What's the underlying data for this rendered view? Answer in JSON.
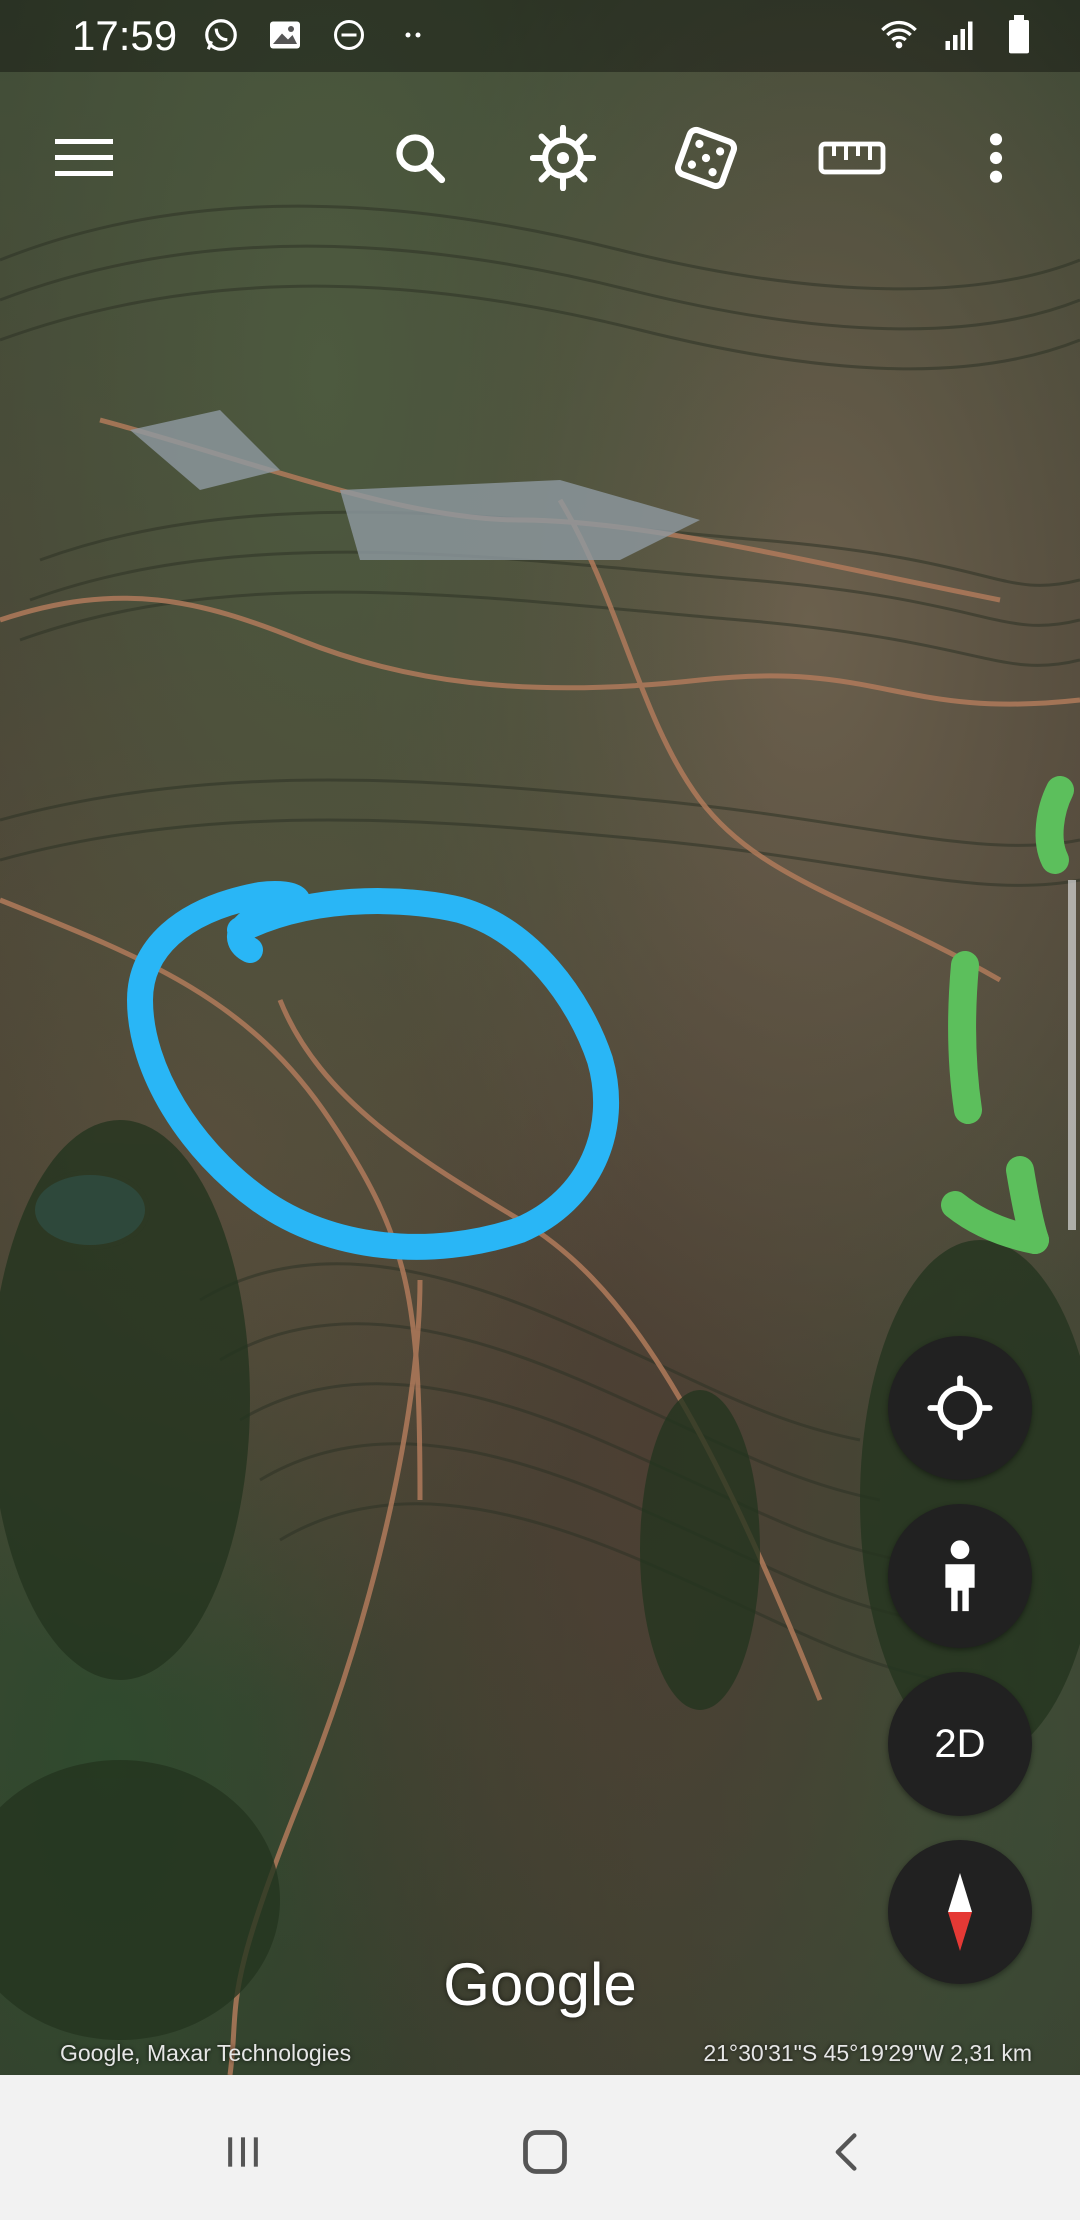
{
  "status_bar": {
    "time": "17:59",
    "left_icons": [
      "whatsapp-icon",
      "gallery-icon",
      "do-not-disturb-icon",
      "more-dots-icon"
    ],
    "right_icons": [
      "wifi-icon",
      "signal-icon",
      "battery-icon"
    ]
  },
  "toolbar": {
    "icons": [
      "menu-icon",
      "search-icon",
      "voyager-icon",
      "feeling-lucky-icon",
      "measure-icon",
      "more-options-icon"
    ]
  },
  "controls": {
    "locate_icon": "my-location-icon",
    "street_view_icon": "pegman-icon",
    "view_mode_label": "2D",
    "compass_icon": "compass-icon"
  },
  "map": {
    "logo_text": "Google",
    "attribution": "Google, Maxar Technologies",
    "coordinates_scale": "21°30'31\"S 45°19'29\"W 2,31 km",
    "annotations": {
      "blue_circle_color": "#29b6f6",
      "green_marks_color": "#5cbf5c"
    }
  },
  "nav_bar": {
    "icons": [
      "recent-apps-icon",
      "home-icon",
      "back-icon"
    ]
  }
}
